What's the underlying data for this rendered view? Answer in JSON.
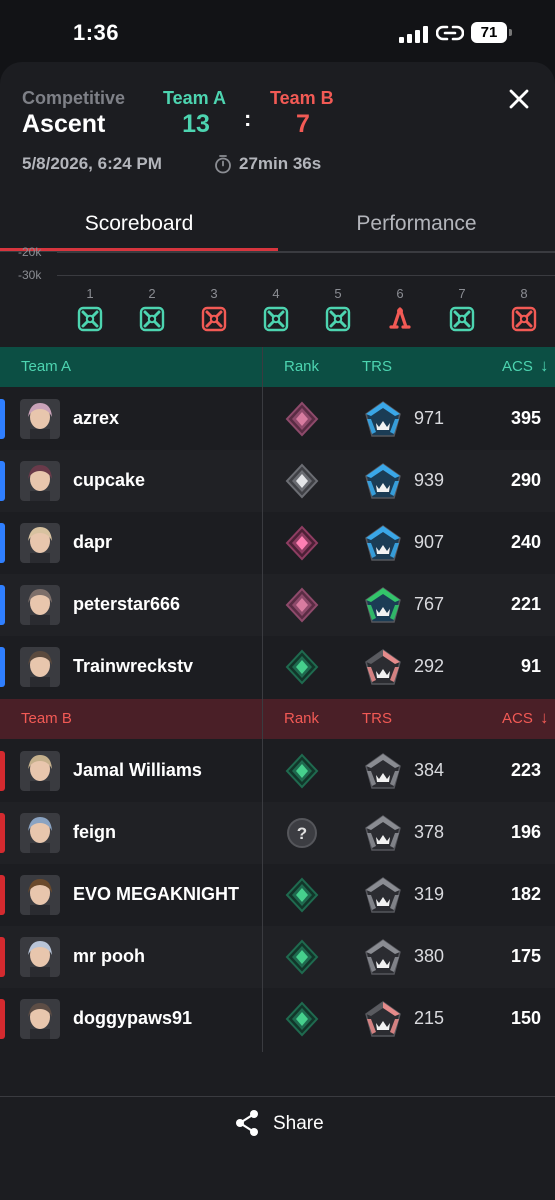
{
  "status_bar": {
    "time": "1:36",
    "battery": "71"
  },
  "match": {
    "mode": "Competitive",
    "map": "Ascent",
    "team_a_label": "Team A",
    "team_a_score": "13",
    "separator": ":",
    "team_b_label": "Team B",
    "team_b_score": "7",
    "date": "5/8/2026, 6:24 PM",
    "duration": "27min 36s"
  },
  "tabs": {
    "scoreboard": "Scoreboard",
    "performance": "Performance"
  },
  "timeline": {
    "axis_labels": [
      "-20k",
      "-30k"
    ],
    "rounds": [
      {
        "num": "1",
        "winner": "A",
        "icon": "elimination-icon"
      },
      {
        "num": "2",
        "winner": "A",
        "icon": "elimination-icon"
      },
      {
        "num": "3",
        "winner": "B",
        "icon": "elimination-icon"
      },
      {
        "num": "4",
        "winner": "A",
        "icon": "elimination-icon"
      },
      {
        "num": "5",
        "winner": "A",
        "icon": "elimination-icon"
      },
      {
        "num": "6",
        "winner": "B",
        "icon": "defuse-icon"
      },
      {
        "num": "7",
        "winner": "A",
        "icon": "elimination-icon"
      },
      {
        "num": "8",
        "winner": "B",
        "icon": "elimination-icon"
      }
    ]
  },
  "columns": {
    "rank": "Rank",
    "trs": "TRS",
    "acs": "ACS",
    "sort_arrow": "↓"
  },
  "team_a": {
    "label": "Team A",
    "players": [
      {
        "name": "azrex",
        "rank": "ascendant",
        "trs_tier": "blue",
        "trs": "971",
        "acs": "395"
      },
      {
        "name": "cupcake",
        "rank": "immortal-silver",
        "trs_tier": "blue",
        "trs": "939",
        "acs": "290"
      },
      {
        "name": "dapr",
        "rank": "ascendant-pink",
        "trs_tier": "blue",
        "trs": "907",
        "acs": "240"
      },
      {
        "name": "peterstar666",
        "rank": "ascendant",
        "trs_tier": "green",
        "trs": "767",
        "acs": "221"
      },
      {
        "name": "Trainwreckstv",
        "rank": "emerald",
        "trs_tier": "red",
        "trs": "292",
        "acs": "91"
      }
    ]
  },
  "team_b": {
    "label": "Team B",
    "players": [
      {
        "name": "Jamal Williams",
        "rank": "emerald",
        "trs_tier": "grey",
        "trs": "384",
        "acs": "223"
      },
      {
        "name": "feign",
        "rank": "unranked",
        "trs_tier": "grey",
        "trs": "378",
        "acs": "196"
      },
      {
        "name": "EVO MEGAKNIGHT",
        "rank": "emerald",
        "trs_tier": "grey",
        "trs": "319",
        "acs": "182"
      },
      {
        "name": "mr pooh",
        "rank": "emerald",
        "trs_tier": "grey",
        "trs": "380",
        "acs": "175"
      },
      {
        "name": "doggypaws91",
        "rank": "emerald",
        "trs_tier": "red",
        "trs": "215",
        "acs": "150"
      }
    ]
  },
  "share_label": "Share",
  "colors": {
    "team_a": "#4dd4b0",
    "team_b": "#f25a55",
    "team_a_header_bg": "#0c4f44",
    "team_b_header_bg": "#4a1f27",
    "team_a_bar": "#2f7fff",
    "team_b_bar": "#d42a2f",
    "tab_accent": "#d7353e"
  }
}
